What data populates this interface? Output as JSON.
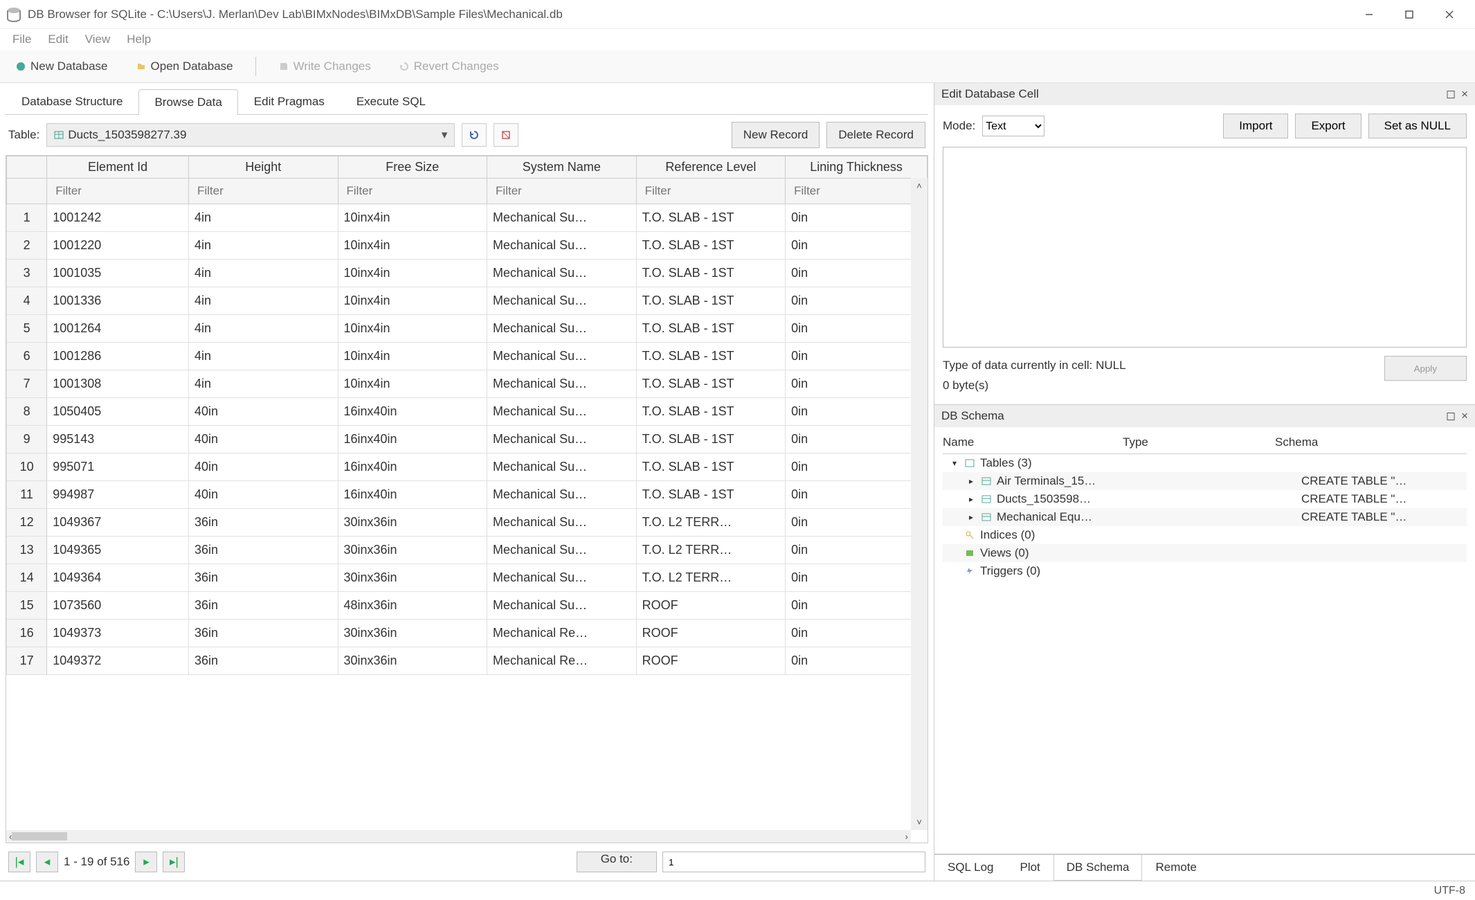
{
  "window": {
    "title": "DB Browser for SQLite - C:\\Users\\J. Merlan\\Dev Lab\\BIMxNodes\\BIMxDB\\Sample Files\\Mechanical.db"
  },
  "menu": {
    "file": "File",
    "edit": "Edit",
    "view": "View",
    "help": "Help"
  },
  "toolbar": {
    "new_db": "New Database",
    "open_db": "Open Database",
    "write": "Write Changes",
    "revert": "Revert Changes"
  },
  "main_tabs": {
    "structure": "Database Structure",
    "browse": "Browse Data",
    "pragmas": "Edit Pragmas",
    "sql": "Execute SQL"
  },
  "browse": {
    "table_label": "Table:",
    "table_name": "Ducts_1503598277.39",
    "new_record": "New Record",
    "delete_record": "Delete Record",
    "filter_placeholder": "Filter",
    "columns": [
      "Element Id",
      "Height",
      "Free Size",
      "System Name",
      "Reference Level",
      "Lining Thickness"
    ],
    "rows": [
      [
        "1001242",
        "4in",
        "10inx4in",
        "Mechanical Su…",
        "T.O. SLAB - 1ST",
        "0in"
      ],
      [
        "1001220",
        "4in",
        "10inx4in",
        "Mechanical Su…",
        "T.O. SLAB - 1ST",
        "0in"
      ],
      [
        "1001035",
        "4in",
        "10inx4in",
        "Mechanical Su…",
        "T.O. SLAB - 1ST",
        "0in"
      ],
      [
        "1001336",
        "4in",
        "10inx4in",
        "Mechanical Su…",
        "T.O. SLAB - 1ST",
        "0in"
      ],
      [
        "1001264",
        "4in",
        "10inx4in",
        "Mechanical Su…",
        "T.O. SLAB - 1ST",
        "0in"
      ],
      [
        "1001286",
        "4in",
        "10inx4in",
        "Mechanical Su…",
        "T.O. SLAB - 1ST",
        "0in"
      ],
      [
        "1001308",
        "4in",
        "10inx4in",
        "Mechanical Su…",
        "T.O. SLAB - 1ST",
        "0in"
      ],
      [
        "1050405",
        "40in",
        "16inx40in",
        "Mechanical Su…",
        "T.O. SLAB - 1ST",
        "0in"
      ],
      [
        "995143",
        "40in",
        "16inx40in",
        "Mechanical Su…",
        "T.O. SLAB - 1ST",
        "0in"
      ],
      [
        "995071",
        "40in",
        "16inx40in",
        "Mechanical Su…",
        "T.O. SLAB - 1ST",
        "0in"
      ],
      [
        "994987",
        "40in",
        "16inx40in",
        "Mechanical Su…",
        "T.O. SLAB - 1ST",
        "0in"
      ],
      [
        "1049367",
        "36in",
        "30inx36in",
        "Mechanical Su…",
        "T.O. L2 TERR…",
        "0in"
      ],
      [
        "1049365",
        "36in",
        "30inx36in",
        "Mechanical Su…",
        "T.O. L2 TERR…",
        "0in"
      ],
      [
        "1049364",
        "36in",
        "30inx36in",
        "Mechanical Su…",
        "T.O. L2 TERR…",
        "0in"
      ],
      [
        "1073560",
        "36in",
        "48inx36in",
        "Mechanical Su…",
        "ROOF",
        "0in"
      ],
      [
        "1049373",
        "36in",
        "30inx36in",
        "Mechanical Re…",
        "ROOF",
        "0in"
      ],
      [
        "1049372",
        "36in",
        "30inx36in",
        "Mechanical Re…",
        "ROOF",
        "0in"
      ]
    ],
    "pager_text": "1 - 19 of 516",
    "goto_label": "Go to:",
    "goto_value": "1"
  },
  "cell_editor": {
    "title": "Edit Database Cell",
    "mode_label": "Mode:",
    "mode_value": "Text",
    "import": "Import",
    "export": "Export",
    "set_null": "Set as NULL",
    "type_info": "Type of data currently in cell: NULL",
    "size_info": "0 byte(s)",
    "apply": "Apply"
  },
  "schema": {
    "title": "DB Schema",
    "col_name": "Name",
    "col_type": "Type",
    "col_schema": "Schema",
    "tables_label": "Tables (3)",
    "table_rows": [
      {
        "name": "Air Terminals_15…",
        "schema": "CREATE TABLE \"…"
      },
      {
        "name": "Ducts_1503598…",
        "schema": "CREATE TABLE \"…"
      },
      {
        "name": "Mechanical Equ…",
        "schema": "CREATE TABLE \"…"
      }
    ],
    "indices": "Indices (0)",
    "views": "Views (0)",
    "triggers": "Triggers (0)"
  },
  "bottom_tabs": {
    "sql_log": "SQL Log",
    "plot": "Plot",
    "db_schema": "DB Schema",
    "remote": "Remote"
  },
  "status": {
    "encoding": "UTF-8"
  }
}
